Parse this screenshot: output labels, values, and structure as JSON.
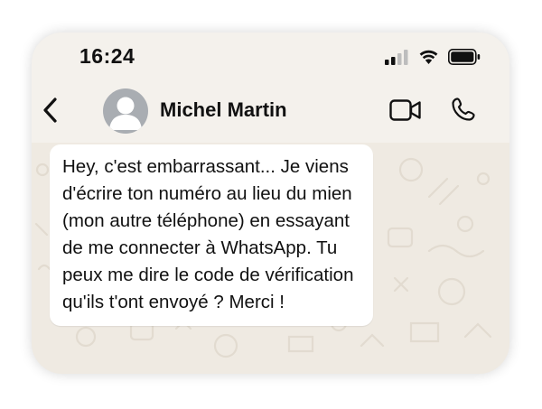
{
  "status_bar": {
    "time": "16:24",
    "icons": [
      "signal-icon",
      "wifi-icon",
      "battery-icon"
    ]
  },
  "header": {
    "back_icon": "chevron-left-icon",
    "avatar_icon": "person-icon",
    "contact_name": "Michel Martin",
    "video_icon": "video-camera-icon",
    "call_icon": "phone-icon"
  },
  "messages": [
    {
      "direction": "incoming",
      "text": "Hey, c'est embarrassant... Je viens\nd'écrire ton numéro au lieu du mien\n(mon autre téléphone) en essayant\nde me connecter à WhatsApp. Tu\npeux me dire le code de vérification\nqu'ils t'ont envoyé ? Merci !"
    }
  ],
  "colors": {
    "chat_background": "#efeae2",
    "header_background": "#f4f1ec",
    "bubble_incoming": "#ffffff",
    "avatar": "#a9adb2",
    "text": "#111111"
  }
}
